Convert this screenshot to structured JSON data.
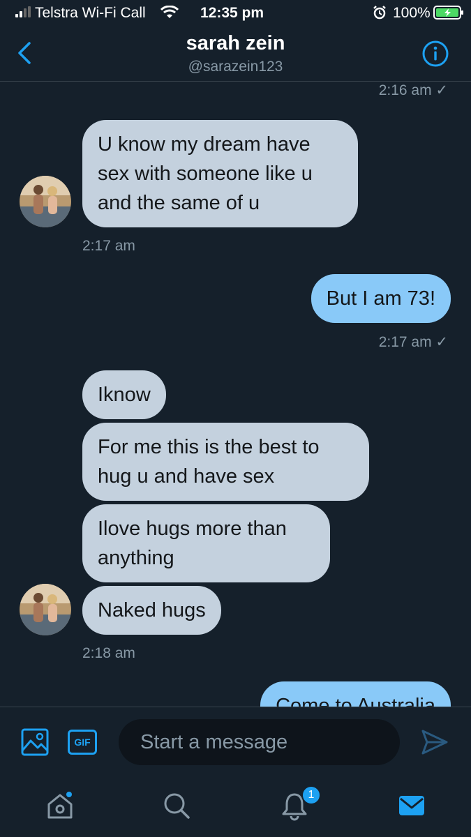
{
  "status_bar": {
    "carrier": "Telstra Wi-Fi Call",
    "time": "12:35 pm",
    "battery": "100%"
  },
  "header": {
    "name": "sarah zein",
    "handle": "@sarazein123"
  },
  "messages": [
    {
      "type": "timestamp",
      "side": "right",
      "text": "2:16 am ✓"
    },
    {
      "type": "bubble",
      "side": "in",
      "text": "U know my dream have\nsex with someone like u\nand the same of u"
    },
    {
      "type": "timestamp",
      "side": "left",
      "text": "2:17 am"
    },
    {
      "type": "bubble",
      "side": "out",
      "text": "But I am 73!"
    },
    {
      "type": "timestamp",
      "side": "right",
      "text": "2:17 am ✓"
    },
    {
      "type": "bubble",
      "side": "in",
      "text": "Iknow"
    },
    {
      "type": "bubble",
      "side": "in",
      "text": "For me this is the best to\nhug u and have sex"
    },
    {
      "type": "bubble",
      "side": "in",
      "text": "Ilove hugs more than\nanything"
    },
    {
      "type": "bubble",
      "side": "in",
      "text": "Naked hugs"
    },
    {
      "type": "timestamp",
      "side": "left",
      "text": "2:18 am"
    },
    {
      "type": "bubble",
      "side": "out",
      "text": "Come to Australia"
    }
  ],
  "composer": {
    "gif_label": "GIF",
    "placeholder": "Start a message"
  },
  "tab_bar": {
    "items": [
      {
        "icon": "home-icon"
      },
      {
        "icon": "search-icon"
      },
      {
        "icon": "bell-icon",
        "badge": "1"
      },
      {
        "icon": "mail-icon",
        "active": true
      }
    ]
  },
  "colors": {
    "background": "#15202b",
    "accent": "#1da1f2",
    "incoming_bubble": "#c4d1de",
    "outgoing_bubble": "#89c9f8",
    "secondary_text": "#8899a6"
  }
}
